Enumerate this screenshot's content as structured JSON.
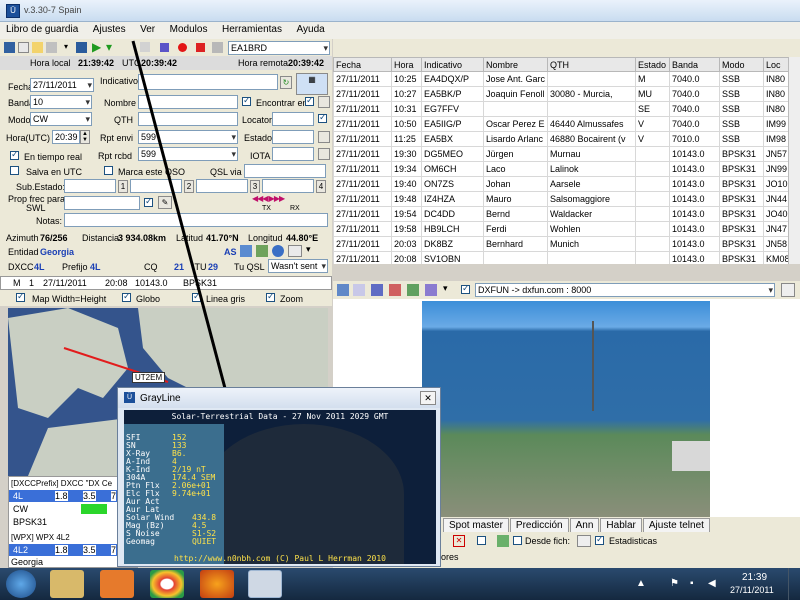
{
  "window": {
    "title": "v.3.30-7 Spain"
  },
  "menu": [
    "Libro de guardia",
    "Ajustes",
    "Ver",
    "Modulos",
    "Herramientas",
    "Ayuda"
  ],
  "toolbar": {
    "callsign": "EA1BRD"
  },
  "times": {
    "local_label": "Hora local",
    "local_value": "21:39:42",
    "utc_label": "UTC",
    "utc_value": "20:39:42",
    "remote_label": "Hora remota",
    "remote_value": "20:39:42"
  },
  "form": {
    "fecha_label": "Fecha",
    "fecha": "27/11/2011",
    "indicativo_label": "Indicativo",
    "banda_label": "Banda",
    "banda": "10",
    "nombre_label": "Nombre",
    "encontrar_label": "Encontrar en",
    "modo_label": "Modo",
    "modo": "CW",
    "qth_label": "QTH",
    "locator_label": "Locator",
    "hora_label": "Hora(UTC)",
    "hora": "20:39",
    "rpt_env_label": "Rpt envi",
    "rpt_env": "599",
    "estado_label": "Estado",
    "rpt_rcbd_label": "Rpt rcbd",
    "rpt_rcbd": "599",
    "iota_label": "IOTA",
    "tiempo_real_label": "En tiempo real",
    "salva_utc_label": "Salva en UTC",
    "marca_qso_label": "Marca este QSO",
    "qsl_via_label": "QSL via",
    "sub_estado_label": "Sub.Estado:",
    "sub_buttons": [
      "1",
      "2",
      "3",
      "4"
    ],
    "prop_label": "Prop frec para",
    "swl_label": "SWL",
    "notas_label": "Notas:",
    "tx_label": "TX",
    "rx_label": "RX"
  },
  "info": {
    "azimuth_label": "Azimuth",
    "azimuth": "76/256",
    "distancia_label": "Distancia",
    "distancia": "3 934.08km",
    "latitud_label": "Latitud",
    "latitud": "41.70°N",
    "longitud_label": "Longitud",
    "longitud": "44.80°E",
    "entidad_label": "Entidad",
    "entidad": "Georgia",
    "as": "AS",
    "dxcc_label": "DXCC",
    "dxcc": "4L",
    "prefijo_label": "Prefijo",
    "prefijo": "4L",
    "cq_label": "CQ",
    "cq": "21",
    "itu_label": "ITU",
    "itu": "29",
    "tuqsl_label": "Tu QSL",
    "tuqsl": "Wasn't sent"
  },
  "statusrow": [
    "M",
    "1",
    "27/11/2011",
    "20:08",
    "10143.0",
    "BPSK31"
  ],
  "mapbar": {
    "map_label": "Map Width=Height",
    "globo_label": "Globo",
    "linea_label": "Linea gris",
    "zoom_label": "Zoom"
  },
  "map_marker": "UT2EM",
  "lower_left": {
    "header1": "[DXCCPrefix] DXCC \"DX Ce",
    "row1": [
      "4L",
      "1.8",
      "3.5",
      "7"
    ],
    "row2": [
      "CW"
    ],
    "row3": [
      "BPSK31"
    ],
    "header2": "[WPX] WPX 4L2",
    "row4": [
      "4L2",
      "1.8",
      "3.5",
      "7"
    ],
    "footer": "Georgia"
  },
  "log_table": {
    "columns": [
      "Fecha",
      "Hora",
      "Indicativo",
      "Nombre",
      "QTH",
      "Estado",
      "Banda",
      "Modo",
      "Loc"
    ],
    "rows": [
      [
        "27/11/2011",
        "10:25",
        "EA4DQX/P",
        "Jose Ant. Garc",
        "",
        "M",
        "7040.0",
        "SSB",
        "IN80"
      ],
      [
        "27/11/2011",
        "10:27",
        "EA5BK/P",
        "Joaquin Fenoll",
        "30080 - Murcia,",
        "MU",
        "7040.0",
        "SSB",
        "IN80"
      ],
      [
        "27/11/2011",
        "10:31",
        "EG7FFV",
        "",
        "",
        "SE",
        "7040.0",
        "SSB",
        "IN80"
      ],
      [
        "27/11/2011",
        "10:50",
        "EA5IIG/P",
        "Oscar Perez E",
        "46440 Almussafes",
        "V",
        "7040.0",
        "SSB",
        "IM99"
      ],
      [
        "27/11/2011",
        "11:25",
        "EA5BX",
        "Lisardo Arlanc",
        "46880 Bocairent (v",
        "V",
        "7010.0",
        "SSB",
        "IM98"
      ],
      [
        "27/11/2011",
        "19:30",
        "DG5MEO",
        "Jürgen",
        "Murnau",
        "",
        "10143.0",
        "BPSK31",
        "JN57"
      ],
      [
        "27/11/2011",
        "19:34",
        "OM6CH",
        "Laco",
        "Lalinok",
        "",
        "10143.0",
        "BPSK31",
        "JN99"
      ],
      [
        "27/11/2011",
        "19:40",
        "ON7ZS",
        "Johan",
        "Aarsele",
        "",
        "10143.0",
        "BPSK31",
        "JO10"
      ],
      [
        "27/11/2011",
        "19:48",
        "IZ4HZA",
        "Mauro",
        "Salsomaggiore",
        "",
        "10143.0",
        "BPSK31",
        "JN44"
      ],
      [
        "27/11/2011",
        "19:54",
        "DC4DD",
        "Bernd",
        "Waldacker",
        "",
        "10143.0",
        "BPSK31",
        "JO40"
      ],
      [
        "27/11/2011",
        "19:58",
        "HB9LCH",
        "Ferdi",
        "Wohlen",
        "",
        "10143.0",
        "BPSK31",
        "JN47"
      ],
      [
        "27/11/2011",
        "20:03",
        "DK8BZ",
        "Bernhard",
        "Munich",
        "",
        "10143.0",
        "BPSK31",
        "JN58"
      ],
      [
        "27/11/2011",
        "20:08",
        "SV1OBN",
        "",
        "",
        "",
        "10143.0",
        "BPSK31",
        "KM08"
      ]
    ]
  },
  "cluster": {
    "server": "DXFUN -> dxfun.com : 8000"
  },
  "bottom_tabs": [
    "Spot master",
    "Predicción",
    "Ann",
    "Hablar",
    "Ajuste telnet"
  ],
  "bottom_row": {
    "desde_label": "Desde fich:",
    "estadisticas_label": "Estadisticas",
    "ores": "ores"
  },
  "grayline": {
    "title": "GrayLine",
    "header": "Solar-Terrestrial Data - 27 Nov 2011 2029 GMT",
    "labels": [
      "SFI",
      "SN",
      "X-Ray",
      "A-Ind",
      "K-Ind",
      "304A",
      "Ptn Flx",
      "Elc Flx",
      "Aur Act",
      "Aur Lat",
      "Solar Wind",
      "Mag (Bz)",
      "S Noise",
      "Geomag"
    ],
    "values": [
      "152",
      "133",
      "B6.",
      "4",
      "2/19 nT",
      "174.4 SEM",
      "2.06e+01",
      "9.74e+01",
      "",
      "",
      "434.8",
      "4.5",
      "S1-S2",
      "QUIET"
    ],
    "footer": "http://www.n0nbh.com (C) Paul L Herrman 2010"
  },
  "clock": {
    "time": "21:39",
    "date": "27/11/2011"
  },
  "colors": {
    "link_blue": "#1a3fb5",
    "grid_red": "#cc0000",
    "sea": "#34548c"
  }
}
